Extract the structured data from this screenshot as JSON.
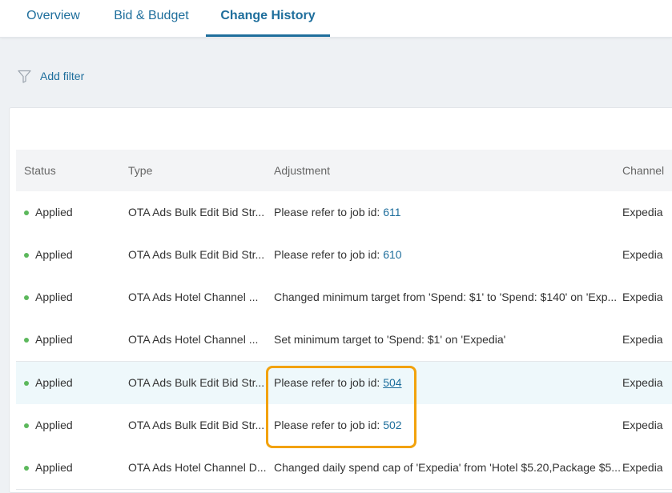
{
  "tabs": [
    {
      "label": "Overview",
      "active": false
    },
    {
      "label": "Bid & Budget",
      "active": false
    },
    {
      "label": "Change History",
      "active": true
    }
  ],
  "filter": {
    "add_label": "Add filter",
    "icon": "funnel-icon"
  },
  "table": {
    "headers": {
      "status": "Status",
      "type": "Type",
      "adjustment": "Adjustment",
      "channel": "Channel"
    },
    "rows": [
      {
        "status": "Applied",
        "type": "OTA Ads Bulk Edit Bid Str...",
        "adjustment": "Please refer to job id: ",
        "job_id": "611",
        "channel": "Expedia"
      },
      {
        "status": "Applied",
        "type": "OTA Ads Bulk Edit Bid Str...",
        "adjustment": "Please refer to job id: ",
        "job_id": "610",
        "channel": "Expedia"
      },
      {
        "status": "Applied",
        "type": "OTA Ads Hotel Channel ...",
        "adjustment": "Changed minimum target from 'Spend: $1' to 'Spend: $140' on 'Exp...",
        "job_id": "",
        "channel": "Expedia"
      },
      {
        "status": "Applied",
        "type": "OTA Ads Hotel Channel ...",
        "adjustment": "Set minimum target to 'Spend: $1' on 'Expedia'",
        "job_id": "",
        "channel": "Expedia"
      },
      {
        "status": "Applied",
        "type": "OTA Ads Bulk Edit Bid Str...",
        "adjustment": "Please refer to job id: ",
        "job_id": "504",
        "channel": "Expedia"
      },
      {
        "status": "Applied",
        "type": "OTA Ads Bulk Edit Bid Str...",
        "adjustment": "Please refer to job id: ",
        "job_id": "502",
        "channel": "Expedia"
      },
      {
        "status": "Applied",
        "type": "OTA Ads Hotel Channel D...",
        "adjustment": "Changed daily spend cap of 'Expedia' from 'Hotel $5.20,Package $5...",
        "job_id": "",
        "channel": "Expedia"
      }
    ]
  },
  "colors": {
    "accent": "#1e6e9c",
    "status_applied": "#5cb85c",
    "highlight_row": "#eef8fb",
    "callout": "#f2a20c"
  }
}
